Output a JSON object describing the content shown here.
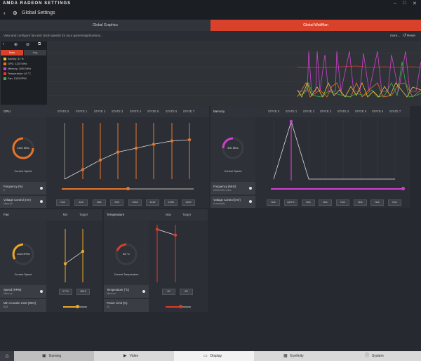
{
  "app": {
    "brand": "AMDA RADEON SETTINGS",
    "title": "Global Settings"
  },
  "tabs": [
    {
      "label": "Global Graphics"
    },
    {
      "label": "Global WattMan"
    }
  ],
  "infobar": {
    "description": "View and configure fan and clock speeds for your games/applications...",
    "more": "more...",
    "reset": "Reset"
  },
  "legend": {
    "now": "Now",
    "avg": "Avg",
    "items": [
      {
        "label": "Activity: 31 %",
        "color": "#e8c23a"
      },
      {
        "label": "GPU: 1120 MHz",
        "color": "#e8742a"
      },
      {
        "label": "Memory: 1050 MHz",
        "color": "#d040d0"
      },
      {
        "label": "Temperature: 48 °C",
        "color": "#e03a2a"
      },
      {
        "label": "Fan: 1333 RPM",
        "color": "#3ab050"
      }
    ]
  },
  "gpu": {
    "title": "GPU",
    "gauge_value": "1100 MHz",
    "gauge_label": "Current Speed",
    "states": [
      "STATE 0",
      "STATE 1",
      "STATE 2",
      "STATE 3",
      "STATE 4",
      "STATE 5",
      "STATE 6",
      "STATE 7"
    ],
    "freq_label": "Frequency (%)",
    "freq_value": "0",
    "volt_label": "Voltage Control (mV)",
    "volt_mode": "Manual",
    "volt_values": [
      "N/A",
      "818",
      "862",
      "903",
      "1062",
      "1112",
      "1138",
      "1150"
    ],
    "state_levels": [
      0.0,
      0.17,
      0.34,
      0.48,
      0.55,
      0.62,
      0.68,
      0.7
    ],
    "freq_slider": 0.5
  },
  "memory": {
    "title": "Memory",
    "gauge_value": "300 MHz",
    "gauge_label": "Current Speed",
    "states": [
      "STATE 0",
      "STATE 1",
      "STATE 2",
      "STATE 3",
      "STATE 4",
      "STATE 5",
      "STATE 6",
      "STATE 7"
    ],
    "freq_label": "Frequency (MHz)",
    "freq_value": "2205 MHz Max",
    "volt_label": "Voltage Control (mV)",
    "volt_mode": "Automatic",
    "volt_values": [
      "N/A",
      "AUTO",
      "N/A",
      "N/A",
      "N/A",
      "N/A",
      "N/A",
      "N/A"
    ],
    "freq_slider": 1.0
  },
  "fan": {
    "title": "Fan",
    "gauge_value": "1316 RPM",
    "gauge_label": "Current Speed",
    "cols": [
      "Min",
      "Target"
    ],
    "speed_label": "Speed (RPM)",
    "speed_mode": "Manual",
    "values": [
      "2770",
      "3819"
    ],
    "acoustic_label": "Min Acoustic Limit (MHz)",
    "acoustic_value": "828",
    "levels": [
      0.35,
      0.58
    ],
    "acoustic_slider": 0.6
  },
  "temperature": {
    "title": "Temperature",
    "gauge_value": "38 °C",
    "gauge_label": "Current Temperature",
    "cols": [
      "Max",
      "Target"
    ],
    "temp_label": "Temperature (°C)",
    "temp_mode": "Manual",
    "values": [
      "90",
      "83"
    ],
    "power_label": "Power Limit (%)",
    "power_value": "20",
    "levels": [
      0.92,
      0.82
    ],
    "power_slider": 0.6
  },
  "bottom_nav": [
    {
      "label": "Gaming",
      "icon": "gamepad-icon"
    },
    {
      "label": "Video",
      "icon": "play-icon"
    },
    {
      "label": "Display",
      "icon": "monitor-icon"
    },
    {
      "label": "Eyefinity",
      "icon": "eyefinity-icon"
    },
    {
      "label": "System",
      "icon": "info-icon"
    }
  ],
  "colors": {
    "accent": "#d9412a",
    "gpu": "#e8742a",
    "memory": "#d040d0",
    "fan": "#e8a82a",
    "temp": "#e03a2a"
  }
}
